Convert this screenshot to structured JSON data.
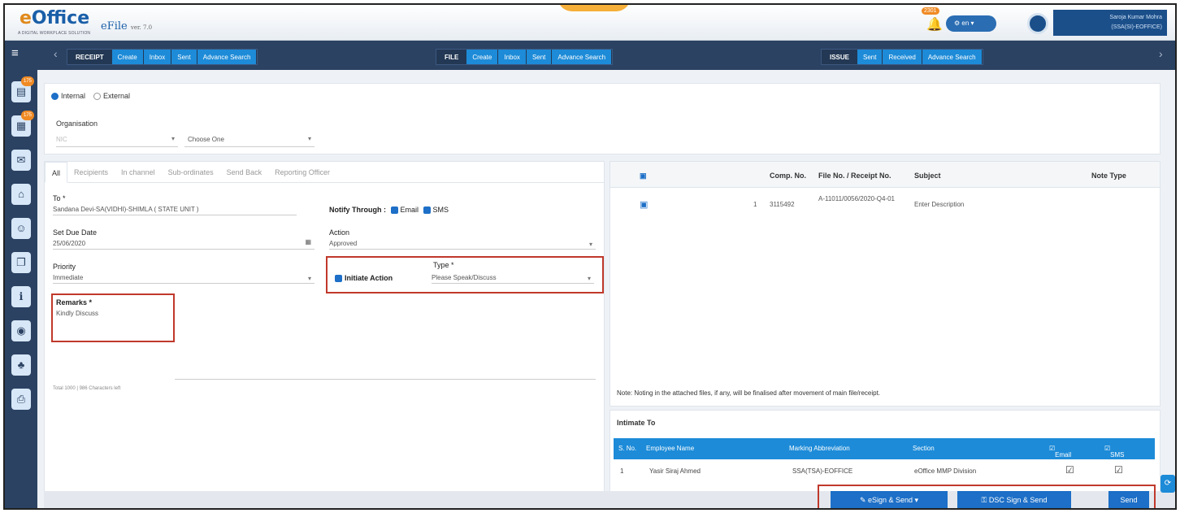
{
  "header": {
    "logo": "eOffice",
    "logo_sub": "A DIGITAL WORKPLACE SOLUTION",
    "product": "eFile",
    "version": "ver. 7.0",
    "notifications": "2301",
    "lang": "en",
    "user_name": "Saroja Kumar Mohra",
    "user_role": "(SSA(SI)-EOFFICE)"
  },
  "nav": {
    "receipt": {
      "caption": "RECEIPT",
      "items": [
        "Create",
        "Inbox",
        "Sent",
        "Advance Search"
      ]
    },
    "file": {
      "caption": "FILE",
      "items": [
        "Create",
        "Inbox",
        "Sent",
        "Advance Search"
      ]
    },
    "issue": {
      "caption": "ISSUE",
      "items": [
        "Sent",
        "Received",
        "Advance Search"
      ]
    }
  },
  "sidebar": {
    "badges": [
      "175",
      "175"
    ]
  },
  "org": {
    "internal": "Internal",
    "external": "External",
    "label": "Organisation",
    "org_value": "NIC",
    "unit_value": "Choose One"
  },
  "tabs": [
    "All",
    "Recipients",
    "In channel",
    "Sub-ordinates",
    "Send Back",
    "Reporting Officer"
  ],
  "form": {
    "to_label": "To *",
    "to_value": "Sandana Devi-SA(VIDHI)-SHIMLA ( STATE UNIT )",
    "notify_label": "Notify Through :",
    "email": "Email",
    "sms": "SMS",
    "due_label": "Set Due Date",
    "due_value": "25/06/2020",
    "action_label": "Action",
    "action_value": "Approved",
    "priority_label": "Priority",
    "priority_value": "Immediate",
    "initiate_label": "Initiate Action",
    "type_label": "Type *",
    "type_value": "Please Speak/Discuss",
    "remarks_label": "Remarks *",
    "remarks_value": "Kindly Discuss",
    "char_info": "Total 1000 | 986 Characters left"
  },
  "file_table": {
    "headers": [
      "Comp. No.",
      "File No. / Receipt No.",
      "Subject",
      "Note Type"
    ],
    "row": {
      "sno": "1",
      "comp": "3115492",
      "file_no": "A-11011/0056/2020-Q4-01",
      "subject": "Enter Description"
    }
  },
  "note": "Note: Noting in the attached files, if any, will be finalised after movement of main file/receipt.",
  "intimate": {
    "title": "Intimate To",
    "headers": [
      "S. No.",
      "Employee Name",
      "Marking Abbreviation",
      "Section",
      "Email",
      "SMS"
    ],
    "row": {
      "sno": "1",
      "name": "Yasir Siraj Ahmed",
      "marking": "SSA(TSA)-EOFFICE",
      "section": "eOffice MMP Division"
    }
  },
  "actions": {
    "esign": "eSign & Send",
    "dsc": "DSC Sign & Send",
    "send": "Send"
  }
}
